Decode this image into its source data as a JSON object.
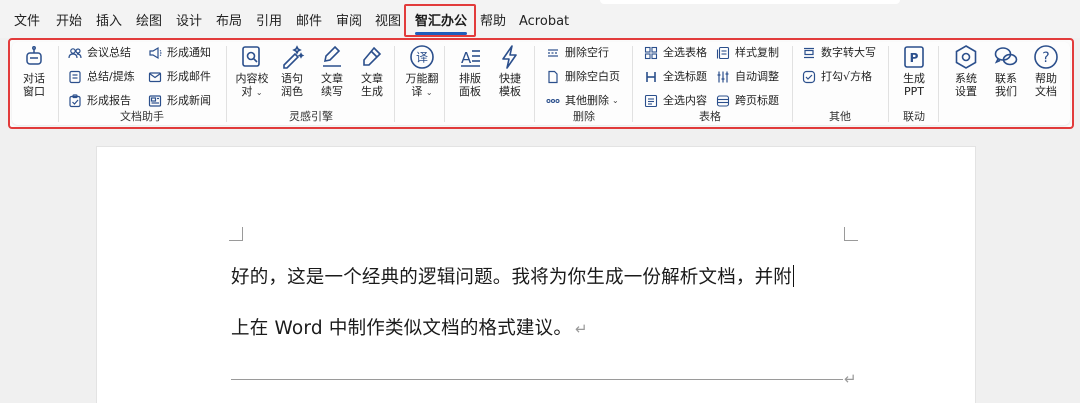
{
  "menu": {
    "tabs": [
      "文件",
      "开始",
      "插入",
      "绘图",
      "设计",
      "布局",
      "引用",
      "邮件",
      "审阅",
      "视图",
      "智汇办公",
      "帮助",
      "Acrobat"
    ],
    "active_tab": "智汇办公"
  },
  "ribbon": {
    "groups": {
      "doc_assistant": {
        "label": "文档助手",
        "dialog_btn": "对话\n窗口",
        "col1": [
          "会议总结",
          "总结/提炼",
          "形成报告"
        ],
        "col2": [
          "形成通知",
          "形成邮件",
          "形成新闻"
        ]
      },
      "inspiration": {
        "label": "灵感引擎",
        "buttons": [
          "内容校\n对",
          "语句\n润色",
          "文章\n续写",
          "文章\n生成"
        ]
      },
      "translate": {
        "button": "万能翻\n译"
      },
      "layout": {
        "buttons": [
          "排版\n面板",
          "快捷\n模板"
        ]
      },
      "delete": {
        "label": "删除",
        "items": [
          "删除空行",
          "删除空白页",
          "其他删除"
        ]
      },
      "table": {
        "label": "表格",
        "col1": [
          "全选表格",
          "全选标题",
          "全选内容"
        ],
        "col2": [
          "样式复制",
          "自动调整",
          "跨页标题"
        ]
      },
      "other": {
        "label": "其他",
        "items": [
          "数字转大写",
          "打勾√方格"
        ]
      },
      "link": {
        "label": "联动",
        "button": "生成\nPPT"
      },
      "support": {
        "buttons": [
          "系统\n设置",
          "联系\n我们",
          "帮助\n文档"
        ]
      }
    }
  },
  "document": {
    "line1": "好的，这是一个经典的逻辑问题。我将为你生成一份解析文档，并附",
    "line2": "上在 Word 中制作类似文档的格式建议。",
    "paragraph_mark": "↵"
  },
  "colors": {
    "accent": "#1f5dbb",
    "highlight": "#e23b3b",
    "icon": "#2b4f8c"
  }
}
